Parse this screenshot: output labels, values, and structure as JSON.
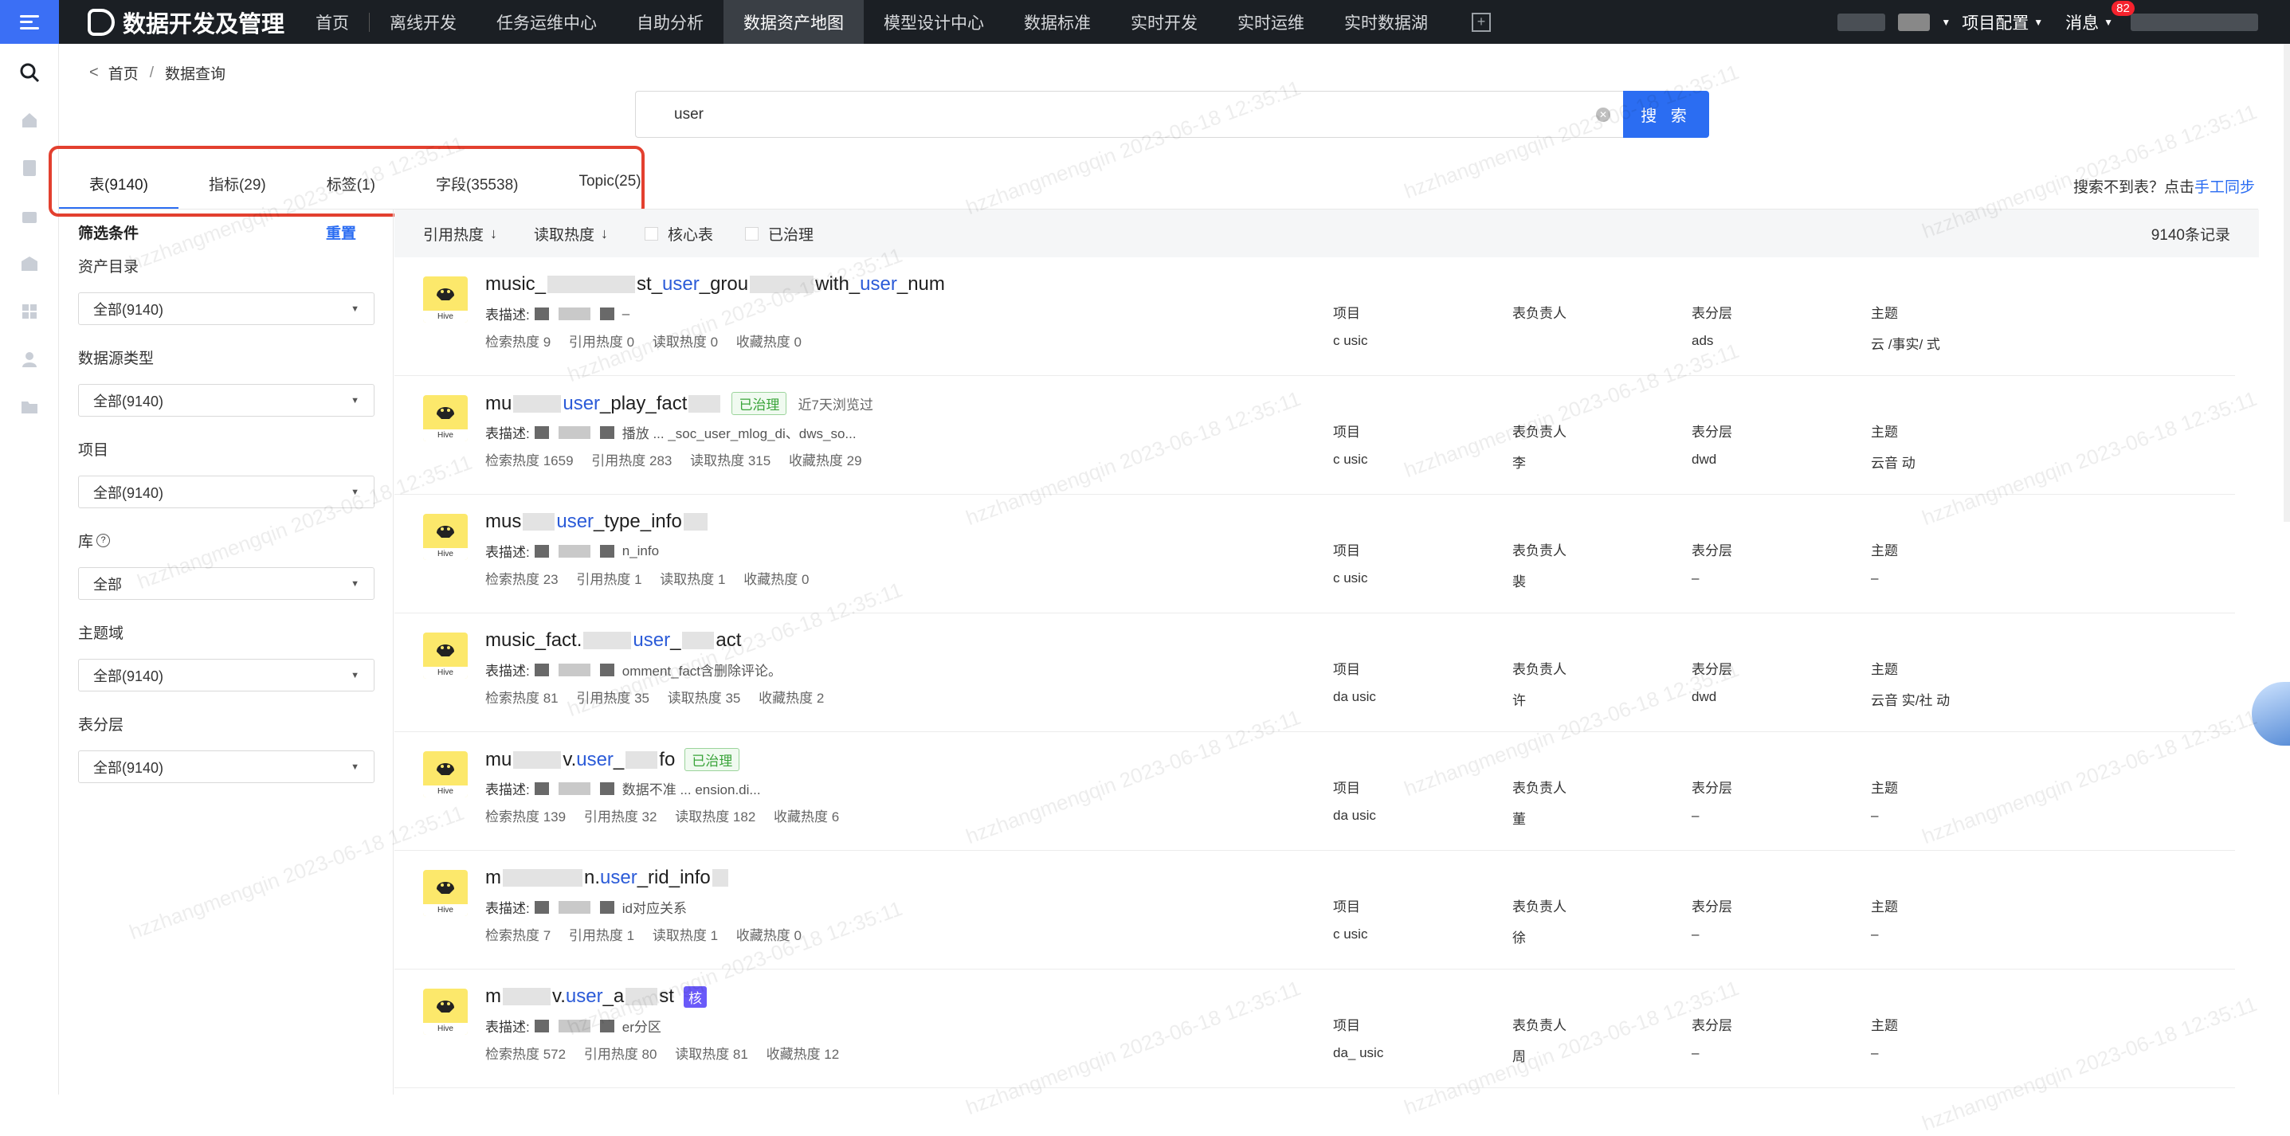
{
  "app": {
    "title": "数据开发及管理"
  },
  "nav": {
    "items": [
      "首页",
      "离线开发",
      "任务运维中心",
      "自助分析",
      "数据资产地图",
      "模型设计中心",
      "数据标准",
      "实时开发",
      "实时运维",
      "实时数据湖"
    ],
    "active": "数据资产地图"
  },
  "top_right": {
    "project_config": "项目配置",
    "messages": "消息",
    "message_count": "82"
  },
  "breadcrumb": {
    "home": "首页",
    "current": "数据查询"
  },
  "search": {
    "value": "user",
    "button": "搜 索"
  },
  "tabs": [
    {
      "label": "表(9140)",
      "active": true
    },
    {
      "label": "指标(29)"
    },
    {
      "label": "标签(1)"
    },
    {
      "label": "字段(35538)"
    },
    {
      "label": "Topic(25)"
    }
  ],
  "manual_sync": {
    "prefix": "搜索不到表？点击",
    "link": "手工同步"
  },
  "filter": {
    "title": "筛选条件",
    "reset": "重置",
    "groups": [
      {
        "label": "资产目录",
        "value": "全部(9140)"
      },
      {
        "label": "数据源类型",
        "value": "全部(9140)"
      },
      {
        "label": "项目",
        "value": "全部(9140)"
      },
      {
        "label": "库",
        "value": "全部",
        "help": "?"
      },
      {
        "label": "主题域",
        "value": "全部(9140)"
      },
      {
        "label": "表分层",
        "value": "全部(9140)"
      }
    ]
  },
  "sortbar": {
    "ref_heat": "引用热度",
    "read_heat": "读取热度",
    "core_table": "核心表",
    "governed": "已治理",
    "total": "9140条记录"
  },
  "rows": [
    {
      "t1": "music_",
      "t2": "st_",
      "hl1": "user",
      "t3": "_grou",
      "t4": "with_",
      "hl2": "user",
      "t5": "_num",
      "desc_label": "表描述:",
      "desc": "–",
      "m": [
        "检索热度 9",
        "引用热度 0",
        "读取热度 0",
        "收藏热度 0"
      ],
      "keys": [
        "项目",
        "表负责人",
        "表分层",
        "主题"
      ],
      "vals": [
        "c  usic",
        "",
        "ads",
        "云  /事实/   式"
      ]
    },
    {
      "t1": "mu",
      "t2": "",
      "hl1": "user",
      "t3": "_play_fact",
      "t4": "",
      "hl2": "",
      "t5": "",
      "pill": "已治理",
      "hot": "近7天浏览过",
      "desc_label": "表描述:",
      "desc": "播放 ... _soc_user_mlog_di、dws_so...",
      "m": [
        "检索热度 1659",
        "引用热度 283",
        "读取热度 315",
        "收藏热度 29"
      ],
      "keys": [
        "项目",
        "表负责人",
        "表分层",
        "主题"
      ],
      "vals": [
        "c  usic",
        "李",
        "dwd",
        "云音     动"
      ]
    },
    {
      "t1": "mus",
      "t2": "",
      "hl1": "user",
      "t3": "_type_info",
      "t4": "",
      "hl2": "",
      "t5": "",
      "desc_label": "表描述:",
      "desc": "n_info",
      "m": [
        "检索热度 23",
        "引用热度 1",
        "读取热度 1",
        "收藏热度 0"
      ],
      "keys": [
        "项目",
        "表负责人",
        "表分层",
        "主题"
      ],
      "vals": [
        "c  usic",
        "裴",
        "–",
        "–"
      ]
    },
    {
      "t1": "music_fact.",
      "t2": "",
      "hl1": "user",
      "t3": "_",
      "t4": "act",
      "hl2": "",
      "t5": "",
      "desc_label": "表描述:",
      "desc": "omment_fact含删除评论。",
      "m": [
        "检索热度 81",
        "引用热度 35",
        "读取热度 35",
        "收藏热度 2"
      ],
      "keys": [
        "项目",
        "表负责人",
        "表分层",
        "主题"
      ],
      "vals": [
        "da  usic",
        "许",
        "dwd",
        "云音  实/社  动"
      ]
    },
    {
      "t1": "mu",
      "t2": "v.",
      "hl1": "user",
      "t3": "_",
      "t4": "fo",
      "hl2": "",
      "t5": "",
      "pill": "已治理",
      "desc_label": "表描述:",
      "desc": "数据不准 ... ension.di...",
      "m": [
        "检索热度 139",
        "引用热度 32",
        "读取热度 182",
        "收藏热度 6"
      ],
      "keys": [
        "项目",
        "表负责人",
        "表分层",
        "主题"
      ],
      "vals": [
        "da  usic",
        "董",
        "–",
        "–"
      ]
    },
    {
      "t1": "m",
      "t2": "n.",
      "hl1": "user",
      "t3": "_rid_info",
      "t4": "",
      "hl2": "",
      "t5": "",
      "desc_label": "表描述:",
      "desc": "id对应关系",
      "m": [
        "检索热度 7",
        "引用热度 1",
        "读取热度 1",
        "收藏热度 0"
      ],
      "keys": [
        "项目",
        "表负责人",
        "表分层",
        "主题"
      ],
      "vals": [
        "c  usic",
        "徐",
        "–",
        "–"
      ]
    },
    {
      "t1": "m",
      "t2": "v.",
      "hl1": "user",
      "t3": "_a",
      "t4": "st",
      "hl2": "",
      "t5": "",
      "core": "核",
      "desc_label": "表描述:",
      "desc": "er分区",
      "m": [
        "检索热度 572",
        "引用热度 80",
        "读取热度 81",
        "收藏热度 12"
      ],
      "keys": [
        "项目",
        "表负责人",
        "表分层",
        "主题"
      ],
      "vals": [
        "da_ usic",
        "周",
        "–",
        "–"
      ]
    }
  ],
  "watermark": "hzzhangmengqin 2023-06-18 12:35:11",
  "colors": {
    "accent": "#2b6df2",
    "highlight_box": "#e3402f",
    "topbar": "#1b1f24"
  }
}
